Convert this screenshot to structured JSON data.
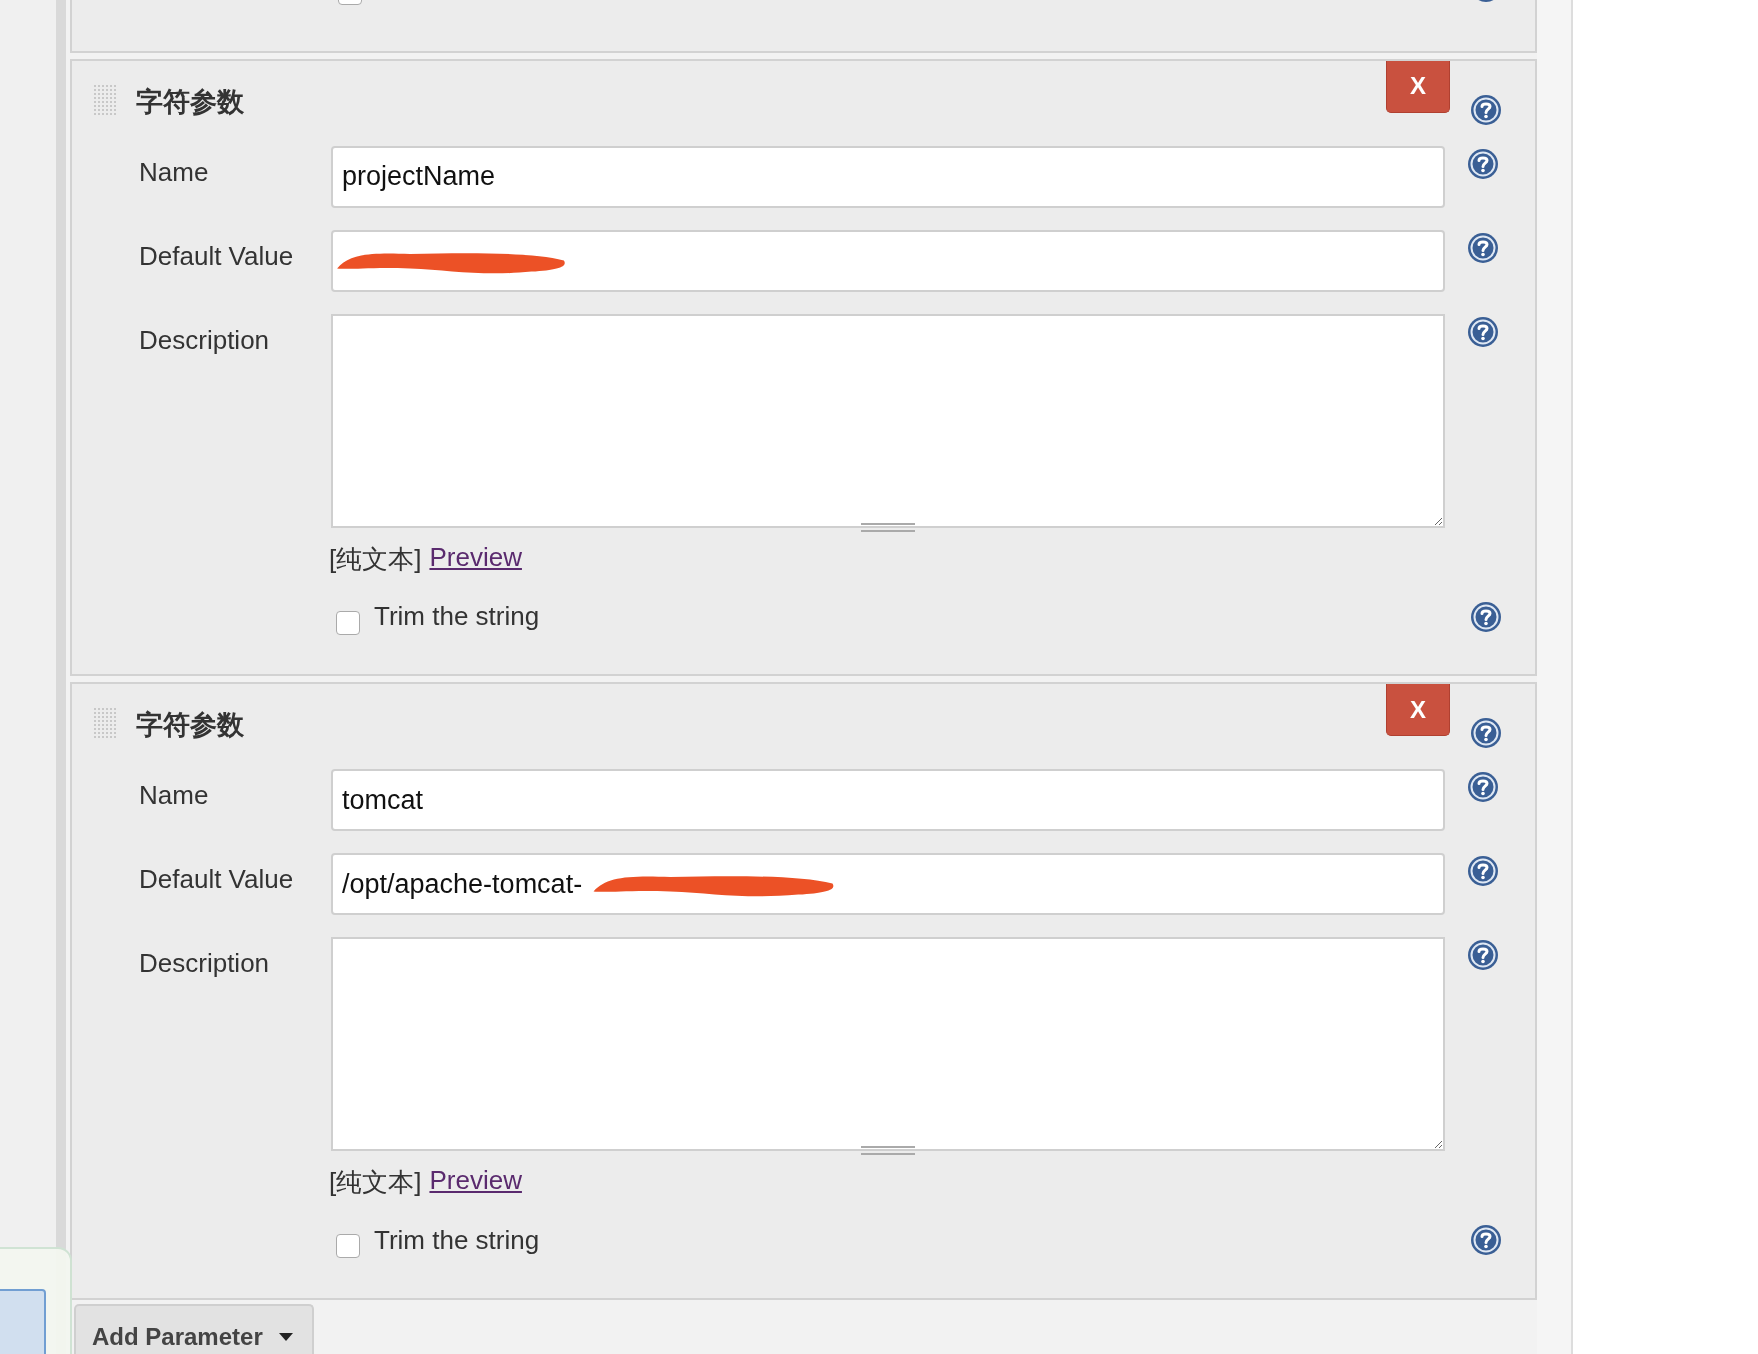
{
  "previous_parameter": {
    "trim": {
      "checked": false
    }
  },
  "parameters": [
    {
      "title": "字符参数",
      "name_label": "Name",
      "name_value": "projectName",
      "default_label": "Default Value",
      "default_redacted": true,
      "description_label": "Description",
      "format": "[纯文本]",
      "preview": "Preview",
      "trim": {
        "label": "Trim the string",
        "checked": false
      },
      "delete": "X"
    },
    {
      "title": "字符参数",
      "name_label": "Name",
      "name_value": "tomcat",
      "default_label": "Default Value",
      "default_value": "/opt/apache-tomcat-",
      "default_redacted": true,
      "description_label": "Description",
      "format": "[纯文本]",
      "preview": "Preview",
      "trim": {
        "label": "Trim the string",
        "checked": false
      },
      "delete": "X"
    }
  ],
  "add_button": {
    "label": "Add Parameter"
  }
}
